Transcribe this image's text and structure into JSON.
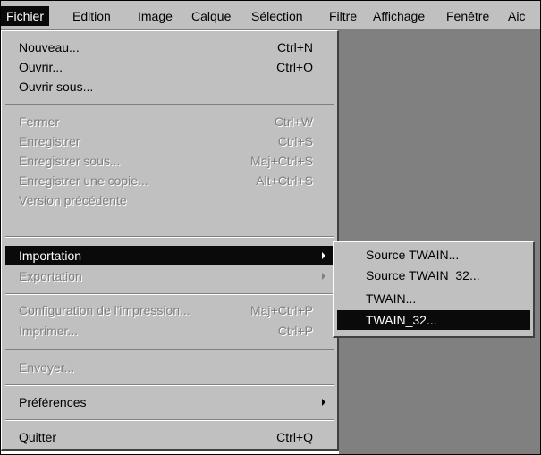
{
  "menubar": {
    "items": [
      {
        "label": "Fichier"
      },
      {
        "label": "Edition"
      },
      {
        "label": "Image"
      },
      {
        "label": "Calque"
      },
      {
        "label": "Sélection"
      },
      {
        "label": "Filtre"
      },
      {
        "label": "Affichage"
      },
      {
        "label": "Fenêtre"
      },
      {
        "label": "Aic"
      }
    ]
  },
  "file_menu": {
    "items": [
      {
        "label": "Nouveau...",
        "shortcut": "Ctrl+N"
      },
      {
        "label": "Ouvrir...",
        "shortcut": "Ctrl+O"
      },
      {
        "label": "Ouvrir sous..."
      },
      {
        "label": "Fermer",
        "shortcut": "Ctrl+W"
      },
      {
        "label": "Enregistrer",
        "shortcut": "Ctrl+S"
      },
      {
        "label": "Enregistrer sous...",
        "shortcut": "Maj+Ctrl+S"
      },
      {
        "label": "Enregistrer une copie...",
        "shortcut": "Alt+Ctrl+S"
      },
      {
        "label": "Version précédente"
      },
      {
        "label": "Importation"
      },
      {
        "label": "Exportation"
      },
      {
        "label": "Configuration de l'impression...",
        "shortcut": "Maj+Ctrl+P"
      },
      {
        "label": "Imprimer...",
        "shortcut": "Ctrl+P"
      },
      {
        "label": "Envoyer..."
      },
      {
        "label": "Préférences"
      },
      {
        "label": "Quitter",
        "shortcut": "Ctrl+Q"
      }
    ]
  },
  "import_submenu": {
    "items": [
      {
        "label": "Source TWAIN..."
      },
      {
        "label": "Source TWAIN_32..."
      },
      {
        "label": "TWAIN..."
      },
      {
        "label": "TWAIN_32..."
      }
    ]
  },
  "colors": {
    "menu_bg": "#c0c0c0",
    "highlight": "#0a0a0a",
    "workspace": "#808080"
  }
}
